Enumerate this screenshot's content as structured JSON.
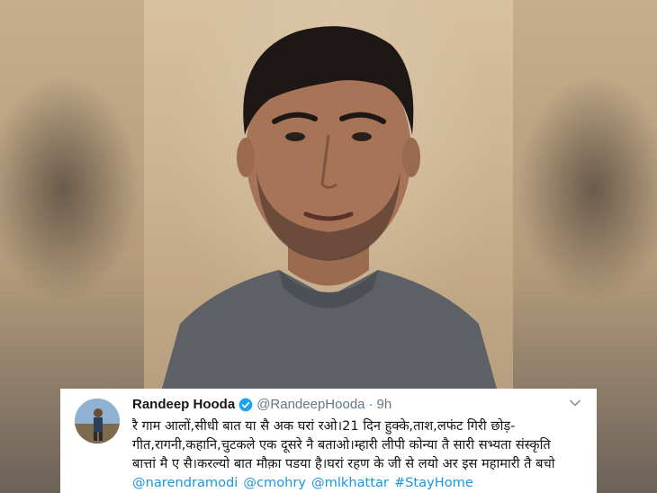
{
  "tweet": {
    "display_name": "Randeep Hooda",
    "handle": "@RandeepHooda",
    "separator": "·",
    "time": "9h",
    "text_lines": [
      "रै गाम आलों,सीधी बात या सै अक घरां रओ।21 दिन हुक्के,ताश,लफंट गिरी छोड़-",
      "गीत,रागनी,कहानि,चुटकले एक दूसरे नै बताओ।म्हारी  लीपी कोन्या तै सारी सभ्यता संस्कृति",
      "बात्तां मै ए सै।करल्यो बात मौक़ा पडया है।घरां रहण के जी से लयो अर इस महामारी तै बचो"
    ],
    "links": [
      "@narendramodi",
      "@cmohry",
      "@mlkhattar",
      "#StayHome"
    ]
  },
  "colors": {
    "link": "#1b95e0",
    "verified": "#1da1f2",
    "secondary_text": "#657786",
    "primary_text": "#14171a"
  },
  "icons": {
    "verified": "verified-badge-icon",
    "caret": "chevron-down-icon"
  }
}
